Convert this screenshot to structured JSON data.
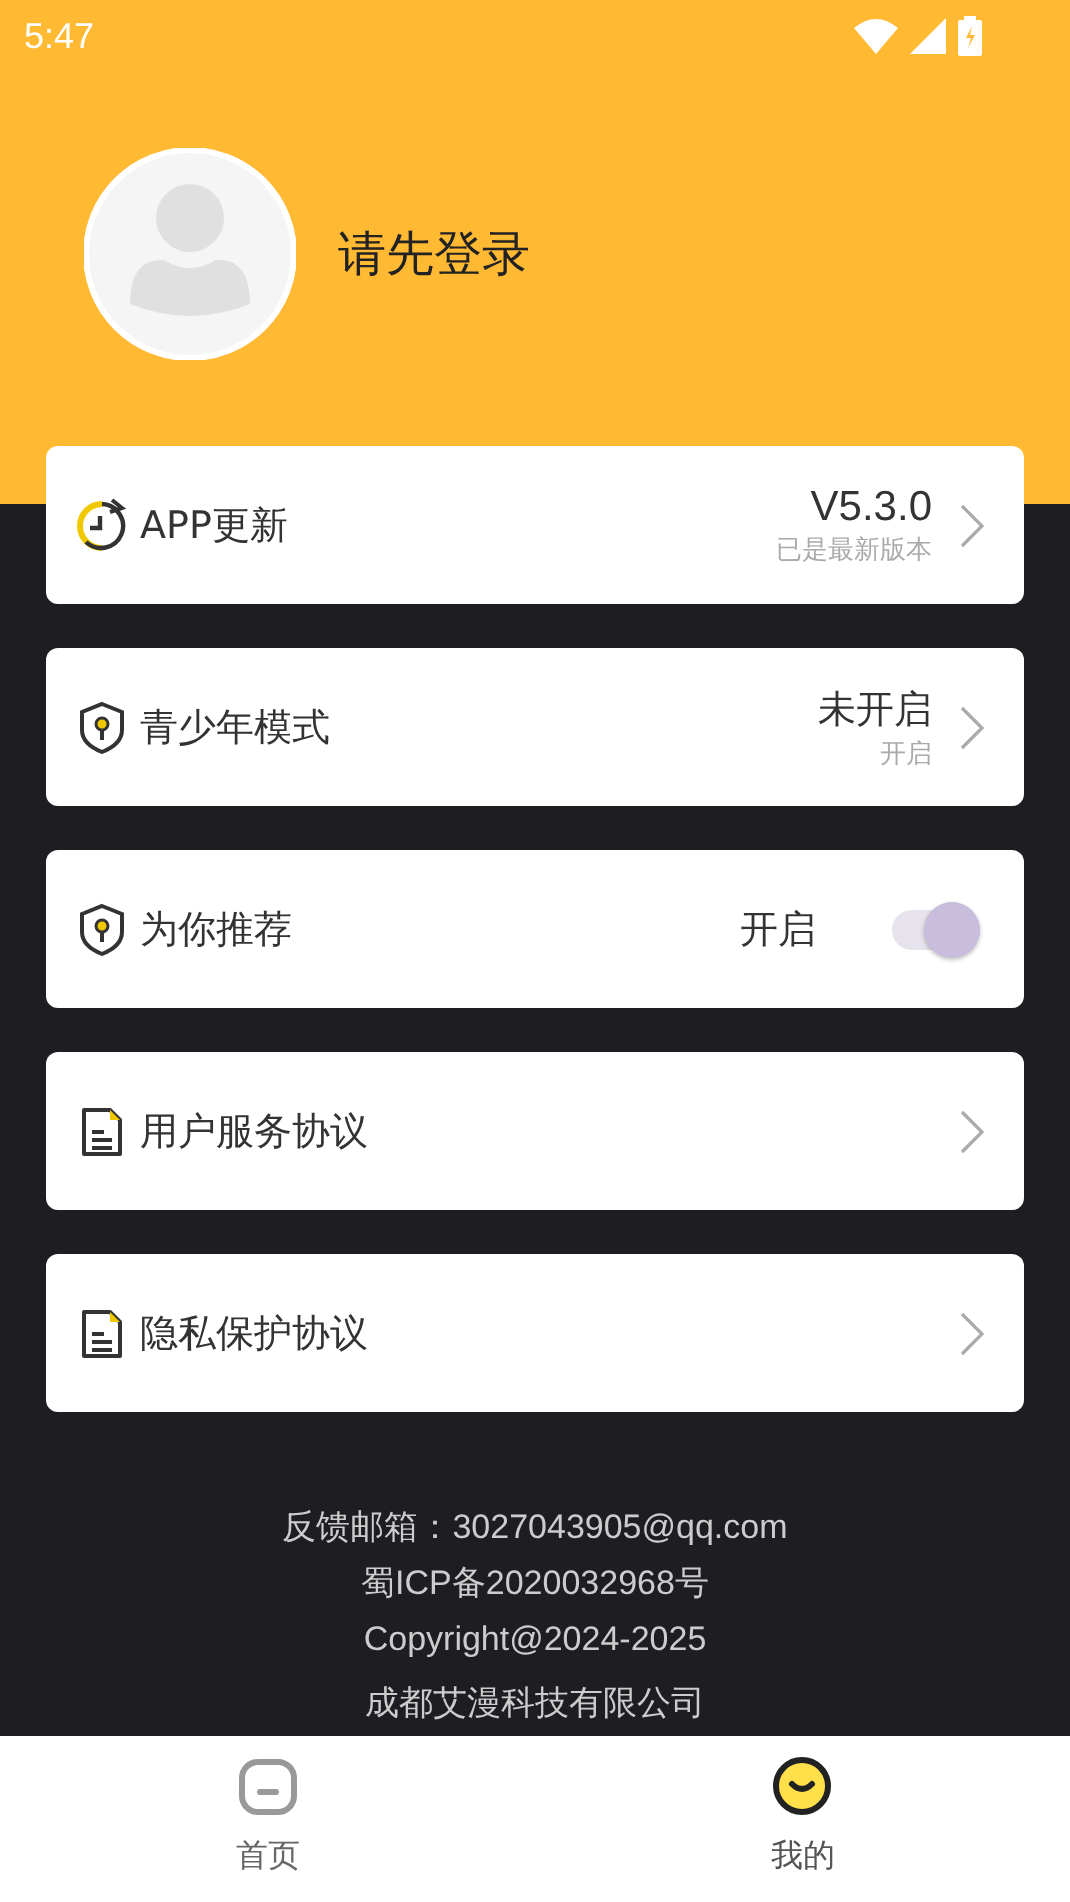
{
  "status_bar": {
    "time": "5:47"
  },
  "profile": {
    "name": "请先登录"
  },
  "items": [
    {
      "kind": "update",
      "label": "APP更新",
      "value": "V5.3.0",
      "sub": "已是最新版本"
    },
    {
      "kind": "mode",
      "label": "青少年模式",
      "value": "未开启",
      "sub": "开启"
    },
    {
      "kind": "toggle",
      "label": "为你推荐",
      "value": "开启",
      "on": true
    },
    {
      "kind": "link",
      "label": "用户服务协议"
    },
    {
      "kind": "link",
      "label": "隐私保护协议"
    }
  ],
  "footer": [
    "反馈邮箱：3027043905@qq.com",
    "蜀ICP备2020032968号",
    "Copyright@2024-2025",
    "成都艾漫科技有限公司"
  ],
  "nav": [
    {
      "label": "首页",
      "selected": false
    },
    {
      "label": "我的",
      "selected": true
    }
  ]
}
